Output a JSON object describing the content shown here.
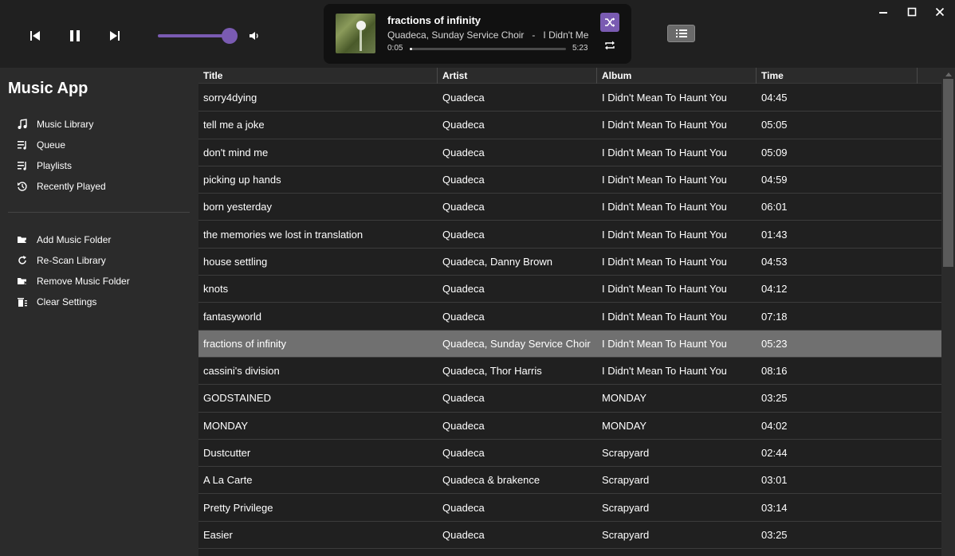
{
  "window": {
    "minimize_icon": "minimize-icon",
    "maximize_icon": "maximize-icon",
    "close_icon": "close-icon"
  },
  "player": {
    "volume_level": 1.0,
    "now_playing": {
      "title": "fractions of infinity",
      "subtitle": "Quadeca, Sunday Service Choir   -   I Didn't Mean To Haunt You",
      "elapsed": "0:05",
      "duration": "5:23",
      "progress": 0.015
    },
    "accent_color": "#7a5bb2"
  },
  "sidebar": {
    "app_title": "Music App",
    "nav": [
      {
        "label": "Music Library",
        "icon": "music-note-icon"
      },
      {
        "label": "Queue",
        "icon": "queue-icon"
      },
      {
        "label": "Playlists",
        "icon": "playlist-icon"
      },
      {
        "label": "Recently Played",
        "icon": "history-icon"
      }
    ],
    "actions": [
      {
        "label": "Add Music Folder",
        "icon": "folder-add-icon"
      },
      {
        "label": "Re-Scan Library",
        "icon": "refresh-icon"
      },
      {
        "label": "Remove Music Folder",
        "icon": "folder-remove-icon"
      },
      {
        "label": "Clear Settings",
        "icon": "trash-icon"
      }
    ]
  },
  "table": {
    "headers": {
      "title": "Title",
      "artist": "Artist",
      "album": "Album",
      "time": "Time"
    },
    "rows": [
      {
        "title": "sorry4dying",
        "artist": "Quadeca",
        "album": "I Didn't Mean To Haunt You",
        "time": "04:45"
      },
      {
        "title": "tell me a joke",
        "artist": "Quadeca",
        "album": "I Didn't Mean To Haunt You",
        "time": "05:05"
      },
      {
        "title": "don't mind me",
        "artist": "Quadeca",
        "album": "I Didn't Mean To Haunt You",
        "time": "05:09"
      },
      {
        "title": "picking up hands",
        "artist": "Quadeca",
        "album": "I Didn't Mean To Haunt You",
        "time": "04:59"
      },
      {
        "title": "born yesterday",
        "artist": "Quadeca",
        "album": "I Didn't Mean To Haunt You",
        "time": "06:01"
      },
      {
        "title": "the memories we lost in translation",
        "artist": "Quadeca",
        "album": "I Didn't Mean To Haunt You",
        "time": "01:43"
      },
      {
        "title": "house settling",
        "artist": "Quadeca, Danny Brown",
        "album": "I Didn't Mean To Haunt You",
        "time": "04:53"
      },
      {
        "title": "knots",
        "artist": "Quadeca",
        "album": "I Didn't Mean To Haunt You",
        "time": "04:12"
      },
      {
        "title": "fantasyworld",
        "artist": "Quadeca",
        "album": "I Didn't Mean To Haunt You",
        "time": "07:18"
      },
      {
        "title": "fractions of infinity",
        "artist": "Quadeca, Sunday Service Choir",
        "album": "I Didn't Mean To Haunt You",
        "time": "05:23",
        "selected": true
      },
      {
        "title": "cassini's division",
        "artist": "Quadeca, Thor Harris",
        "album": "I Didn't Mean To Haunt You",
        "time": "08:16"
      },
      {
        "title": "GODSTAINED",
        "artist": "Quadeca",
        "album": "MONDAY",
        "time": "03:25"
      },
      {
        "title": "MONDAY",
        "artist": "Quadeca",
        "album": "MONDAY",
        "time": "04:02"
      },
      {
        "title": "Dustcutter",
        "artist": "Quadeca",
        "album": "Scrapyard",
        "time": "02:44"
      },
      {
        "title": "A La Carte",
        "artist": "Quadeca & brakence",
        "album": "Scrapyard",
        "time": "03:01"
      },
      {
        "title": "Pretty Privilege",
        "artist": "Quadeca",
        "album": "Scrapyard",
        "time": "03:14"
      },
      {
        "title": "Easier",
        "artist": "Quadeca",
        "album": "Scrapyard",
        "time": "03:25"
      }
    ]
  }
}
